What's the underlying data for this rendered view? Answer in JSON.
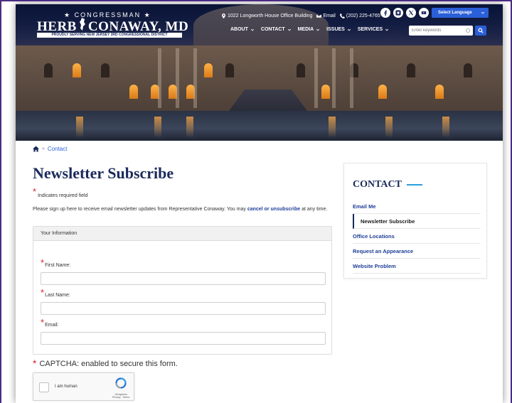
{
  "header": {
    "logo_top": "★ CONGRESSMAN ★",
    "logo_name_left": "HERB",
    "logo_name_right": "CONAWAY, MD",
    "logo_tagline": "PROUDLY SERVING NEW JERSEY 3RD CONGRESSIONAL DISTRICT",
    "address": "1022 Longworth House Office Building",
    "email_label": "Email",
    "phone": "(202) 225-4765",
    "language_label": "Select Language",
    "search_placeholder": "Enter keywords",
    "nav": [
      "ABOUT",
      "CONTACT",
      "MEDIA",
      "ISSUES",
      "SERVICES"
    ],
    "social_icons": [
      "facebook-icon",
      "instagram-icon",
      "x-icon",
      "youtube-icon"
    ]
  },
  "breadcrumb": {
    "home_icon": "home-icon",
    "current": "Contact"
  },
  "main": {
    "title": "Newsletter Subscribe",
    "required_note": "Indicates required field",
    "intro_text": "Please sign up here to receive email newsletter updates from Representative Conaway. You may",
    "intro_link": "cancel or unsubscribe",
    "intro_tail": "at any time.",
    "fieldset_legend": "Your Information",
    "fields": [
      {
        "label": "First Name:",
        "value": ""
      },
      {
        "label": "Last Name:",
        "value": ""
      },
      {
        "label": "Email:",
        "value": ""
      }
    ],
    "captcha_label": "CAPTCHA: enabled to secure this form.",
    "recaptcha_text": "I am human",
    "recaptcha_brand": "hCaptcha",
    "recaptcha_links": "Privacy - Terms"
  },
  "sidebar": {
    "title": "CONTACT",
    "items": [
      {
        "label": "Email Me",
        "active": false
      },
      {
        "label": "Newsletter Subscribe",
        "active": true
      },
      {
        "label": "Office Locations",
        "active": false
      },
      {
        "label": "Request an Appearance",
        "active": false
      },
      {
        "label": "Website Problem",
        "active": false
      }
    ]
  },
  "colors": {
    "brand_navy": "#1a2a5c",
    "link_blue": "#1f3f99",
    "button_blue": "#2b5fd9",
    "required_red": "#d7262e",
    "accent_dash": "#2b9fe0",
    "frame_purple": "#4a2c82"
  }
}
